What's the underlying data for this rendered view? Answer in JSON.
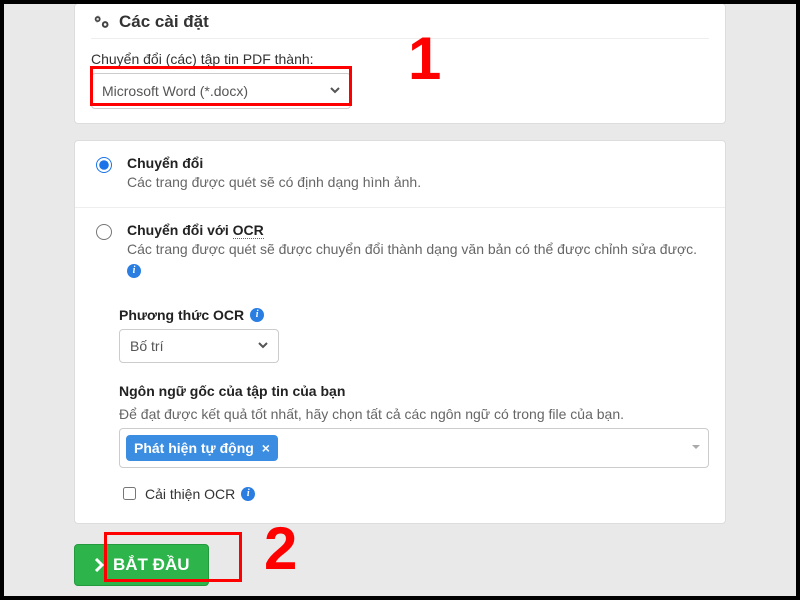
{
  "header": {
    "title": "Các cài đặt"
  },
  "convert": {
    "label": "Chuyển đổi (các) tập tin PDF thành:",
    "selected": "Microsoft Word (*.docx)"
  },
  "options": {
    "convert": {
      "title": "Chuyển đổi",
      "desc": "Các trang được quét sẽ có định dạng hình ảnh."
    },
    "ocr": {
      "title_prefix": "Chuyển đổi với ",
      "title_term": "OCR",
      "desc": "Các trang được quét sẽ được chuyển đổi thành dạng văn bản có thể được chỉnh sửa được.",
      "method_label": "Phương thức OCR",
      "method_selected": "Bố trí",
      "lang_label": "Ngôn ngữ gốc của tập tin của bạn",
      "lang_desc": "Để đạt được kết quả tốt nhất, hãy chọn tất cả các ngôn ngữ có trong file của bạn.",
      "lang_chip": "Phát hiện tự động",
      "improve_label": "Cải thiện OCR"
    }
  },
  "actions": {
    "start": "BẮT ĐẦU"
  },
  "annotations": {
    "one": "1",
    "two": "2"
  }
}
